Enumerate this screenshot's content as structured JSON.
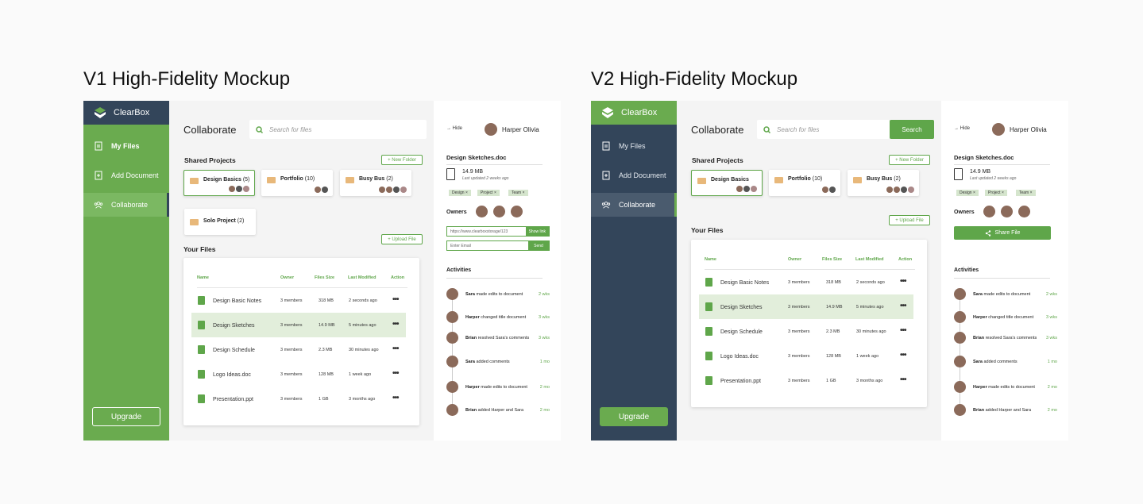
{
  "titles": {
    "v1": "V1 High-Fidelity Mockup",
    "v2": "V2 High-Fidelity Mockup"
  },
  "colors": {
    "green": "#5fa64a",
    "navy": "#33455a",
    "light_green": "#e2eedb",
    "folder": "#e8b87a"
  },
  "app": {
    "brand": "ClearBox",
    "nav": [
      "My Files",
      "Add Document",
      "Collaborate"
    ],
    "upgrade": "Upgrade",
    "page_title": "Collaborate",
    "search_placeholder": "Search for files",
    "search_button": "Search",
    "shared_projects": "Shared Projects",
    "new_folder": "+ New Folder",
    "upload_file": "+ Upload File",
    "your_files": "Your Files",
    "folders": [
      {
        "name": "Design Basics",
        "count": "(5)"
      },
      {
        "name": "Portfolio",
        "count": "(10)"
      },
      {
        "name": "Busy Bus",
        "count": "(2)"
      },
      {
        "name": "Solo Project",
        "count": "(2)"
      }
    ],
    "table_headers": [
      "Name",
      "Owner",
      "Files Size",
      "Last Modified",
      "Action"
    ],
    "files": [
      {
        "name": "Design Basic Notes",
        "owner": "3 members",
        "size": "318 MB",
        "modified": "2 seconds ago",
        "action": "•••"
      },
      {
        "name": "Design Sketches",
        "owner": "3 members",
        "size": "14.9 MB",
        "modified": "5 minutes ago",
        "action": "•••"
      },
      {
        "name": "Design Schedule",
        "owner": "3 members",
        "size": "2.3 MB",
        "modified": "30 minutes ago",
        "action": "•••"
      },
      {
        "name": "Logo Ideas.doc",
        "owner": "3 members",
        "size": "128 MB",
        "modified": "1 week ago",
        "action": "•••"
      },
      {
        "name": "Presentation.ppt",
        "owner": "3 members",
        "size": "1 GB",
        "modified": "3 months ago",
        "action": "•••"
      }
    ],
    "panel": {
      "hide": "Hide",
      "user": "Harper Olivia",
      "doc_title": "Design Sketches.doc",
      "doc_size": "14.9 MB",
      "doc_updated": "Last updated 2 weeks ago",
      "tags": [
        "Design ×",
        "Project ×",
        "Team ×"
      ],
      "owners": "Owners",
      "link": "https://www.clearboxstorage/123",
      "show_link": "Show link",
      "email_placeholder": "Enter Email",
      "send": "Send",
      "share_file": "Share File",
      "activities": "Activities",
      "activity": [
        {
          "who": "Sara",
          "text": " made edits to document",
          "time": "2 wks"
        },
        {
          "who": "Harper",
          "text": " changed title document",
          "time": "3 wks"
        },
        {
          "who": "Brian",
          "text": " resolved Sara's comments",
          "time": "3 wks"
        },
        {
          "who": "Sara",
          "text": " added comments",
          "time": "1 mo"
        },
        {
          "who": "Harper",
          "text": " made edits to document",
          "time": "2 mo"
        },
        {
          "who": "Brian",
          "text": " added Harper and Sara",
          "time": "2 mo"
        }
      ]
    }
  }
}
